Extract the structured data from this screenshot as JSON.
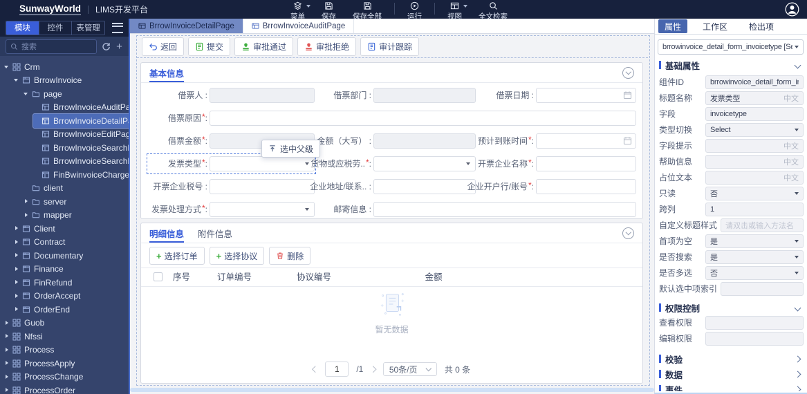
{
  "colors": {
    "accent": "#3a5ed9",
    "header_bg": "#17213d",
    "sidebar_bg": "#35446c",
    "tree_selected": "#4d6cb8",
    "editor_tab_active": "#7289c4",
    "required": "#e23c3c",
    "success": "#3fae3f",
    "danger": "#e05454"
  },
  "header": {
    "logo": "SunwayWorld",
    "product": "LIMS开发平台",
    "actions": [
      {
        "label": "菜单",
        "icon": "layers",
        "dropdown": true
      },
      {
        "label": "保存",
        "icon": "save"
      },
      {
        "label": "保存全部",
        "icon": "saveall",
        "separator_after": true
      },
      {
        "label": "运行",
        "icon": "run",
        "separator_after": true
      },
      {
        "label": "视图",
        "icon": "view",
        "dropdown": true
      },
      {
        "label": "全文检索",
        "icon": "search"
      }
    ]
  },
  "sidebar": {
    "tabs": [
      {
        "label": "模块",
        "active": true
      },
      {
        "label": "控件"
      },
      {
        "label": "表管理"
      }
    ],
    "search_placeholder": "搜索",
    "tree": [
      {
        "label": "Crm",
        "level": 0,
        "icon": "grid",
        "caret": "down"
      },
      {
        "label": "BrrowInvoice",
        "level": 1,
        "icon": "module",
        "caret": "down"
      },
      {
        "label": "page",
        "level": 2,
        "icon": "folder",
        "caret": "down"
      },
      {
        "label": "BrrowInvoiceAuditPage",
        "level": 3,
        "icon": "page"
      },
      {
        "label": "BrrowInvoiceDetailPage",
        "level": 3,
        "icon": "page",
        "selected": true
      },
      {
        "label": "BrrowInvoiceEditPage",
        "level": 3,
        "icon": "page"
      },
      {
        "label": "BrrowInvoiceSearchDealPage",
        "level": 3,
        "icon": "page"
      },
      {
        "label": "BrrowInvoiceSearchPage",
        "level": 3,
        "icon": "page"
      },
      {
        "label": "FinBwinvoiceChargeDetailPage",
        "level": 3,
        "icon": "page"
      },
      {
        "label": "client",
        "level": 2,
        "icon": "folder"
      },
      {
        "label": "server",
        "level": 2,
        "icon": "folder",
        "caret": "right"
      },
      {
        "label": "mapper",
        "level": 2,
        "icon": "folder",
        "caret": "right"
      },
      {
        "label": "Client",
        "level": 1,
        "icon": "module",
        "caret": "right"
      },
      {
        "label": "Contract",
        "level": 1,
        "icon": "module",
        "caret": "right"
      },
      {
        "label": "Documentary",
        "level": 1,
        "icon": "module",
        "caret": "right"
      },
      {
        "label": "Finance",
        "level": 1,
        "icon": "module",
        "caret": "right"
      },
      {
        "label": "FinRefund",
        "level": 1,
        "icon": "module",
        "caret": "right"
      },
      {
        "label": "OrderAccept",
        "level": 1,
        "icon": "module",
        "caret": "right"
      },
      {
        "label": "OrderEnd",
        "level": 1,
        "icon": "module",
        "caret": "right"
      },
      {
        "label": "Guob",
        "level": 0,
        "icon": "grid",
        "caret": "right"
      },
      {
        "label": "Nfssi",
        "level": 0,
        "icon": "grid",
        "caret": "right"
      },
      {
        "label": "Process",
        "level": 0,
        "icon": "grid",
        "caret": "right"
      },
      {
        "label": "ProcessApply",
        "level": 0,
        "icon": "grid",
        "caret": "right"
      },
      {
        "label": "ProcessChange",
        "level": 0,
        "icon": "grid",
        "caret": "right"
      },
      {
        "label": "ProcessOrder",
        "level": 0,
        "icon": "grid",
        "caret": "right"
      }
    ]
  },
  "main": {
    "tabs": [
      {
        "label": "BrrowInvoiceDetailPage",
        "active": true
      },
      {
        "label": "BrrowInvoiceAuditPage"
      }
    ],
    "toolbar": [
      {
        "label": "返回",
        "icon": "back"
      },
      {
        "label": "提交",
        "icon": "submit"
      },
      {
        "label": "审批通过",
        "icon": "approve"
      },
      {
        "label": "审批拒绝",
        "icon": "reject"
      },
      {
        "label": "审计跟踪",
        "icon": "audit"
      }
    ],
    "tooltip": "选中父级",
    "basic_section": {
      "tab": "基本信息",
      "rows": [
        [
          {
            "label": "借票人",
            "type": "text",
            "disabled": true
          },
          {
            "label": "借票部门",
            "type": "text",
            "disabled": true
          },
          {
            "label": "借票日期",
            "type": "date"
          }
        ],
        [
          {
            "label": "借票原因",
            "required": true,
            "type": "text",
            "span": "full"
          }
        ],
        [
          {
            "label": "借票金额",
            "required": true,
            "type": "text",
            "disabled": true
          },
          {
            "label": "金额（大写）",
            "type": "text",
            "disabled": true
          },
          {
            "label": "预计到账时间",
            "required": true,
            "type": "date"
          }
        ],
        [
          {
            "label": "发票类型",
            "required": true,
            "type": "select",
            "selected": true
          },
          {
            "label": "货物或应税劳..",
            "required": true,
            "type": "select"
          },
          {
            "label": "开票企业名称",
            "required": true,
            "type": "text"
          }
        ],
        [
          {
            "label": "开票企业税号",
            "type": "text"
          },
          {
            "label": "企业地址/联系..",
            "type": "text"
          },
          {
            "label": "企业开户行/账号",
            "required": true,
            "type": "text"
          }
        ],
        [
          {
            "label": "发票处理方式",
            "required": true,
            "type": "select"
          },
          {
            "label": "邮寄信息",
            "type": "text",
            "span": "wide"
          }
        ]
      ]
    },
    "detail_section": {
      "tabs": [
        {
          "label": "明细信息",
          "active": true
        },
        {
          "label": "附件信息"
        }
      ],
      "buttons": [
        {
          "label": "选择订单",
          "icon": "plus"
        },
        {
          "label": "选择协议",
          "icon": "plus"
        },
        {
          "label": "删除",
          "icon": "trash"
        }
      ],
      "table": {
        "columns": [
          "序号",
          "订单编号",
          "协议编号",
          "金额"
        ],
        "empty_text": "暂无数据"
      },
      "pagination": {
        "page": "1",
        "of": "/1",
        "size": "50条/页",
        "total": "共 0 条"
      }
    }
  },
  "inspector": {
    "tabs": [
      {
        "label": "属性",
        "active": true
      },
      {
        "label": "工作区"
      },
      {
        "label": "检出项"
      }
    ],
    "component_selector": "brrowinvoice_detail_form_invoicetype [Select]",
    "sections": [
      {
        "title": "基础属性",
        "rows": [
          {
            "label": "组件ID",
            "value": "brrowinvoice_detail_form_invoic",
            "type": "text"
          },
          {
            "label": "标题名称",
            "value": "发票类型",
            "suffix": "中文",
            "type": "text"
          },
          {
            "label": "字段",
            "value": "invoicetype",
            "type": "text"
          },
          {
            "label": "类型切换",
            "value": "Select",
            "type": "select"
          },
          {
            "label": "字段提示",
            "value": "",
            "suffix": "中文",
            "type": "text"
          },
          {
            "label": "帮助信息",
            "value": "",
            "suffix": "中文",
            "type": "text"
          },
          {
            "label": "占位文本",
            "value": "",
            "suffix": "中文",
            "type": "text"
          },
          {
            "label": "只读",
            "value": "否",
            "type": "select"
          },
          {
            "label": "跨列",
            "value": "1",
            "type": "text"
          },
          {
            "label": "自定义标题样式",
            "value": "",
            "placeholder": "请双击或输入方法名",
            "type": "text"
          },
          {
            "label": "首项为空",
            "value": "是",
            "type": "select"
          },
          {
            "label": "是否搜索",
            "value": "是",
            "type": "select"
          },
          {
            "label": "是否多选",
            "value": "否",
            "type": "select"
          },
          {
            "label": "默认选中项索引",
            "value": "",
            "type": "text"
          }
        ]
      },
      {
        "title": "权限控制",
        "rows": [
          {
            "label": "查看权限",
            "value": "",
            "type": "text"
          },
          {
            "label": "编辑权限",
            "value": "",
            "type": "text"
          }
        ]
      },
      {
        "title": "校验",
        "collapsed": true
      },
      {
        "title": "数据",
        "collapsed": true
      },
      {
        "title": "事件",
        "collapsed": true
      }
    ]
  }
}
